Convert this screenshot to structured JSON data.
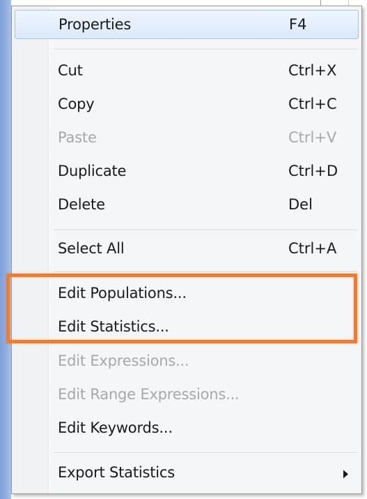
{
  "context_menu": {
    "items": [
      {
        "label": "Properties",
        "shortcut": "F4",
        "enabled": true,
        "hovered": true
      },
      {
        "label": "Cut",
        "shortcut": "Ctrl+X",
        "enabled": true
      },
      {
        "label": "Copy",
        "shortcut": "Ctrl+C",
        "enabled": true
      },
      {
        "label": "Paste",
        "shortcut": "Ctrl+V",
        "enabled": false
      },
      {
        "label": "Duplicate",
        "shortcut": "Ctrl+D",
        "enabled": true
      },
      {
        "label": "Delete",
        "shortcut": "Del",
        "enabled": true
      },
      {
        "label": "Select All",
        "shortcut": "Ctrl+A",
        "enabled": true
      },
      {
        "label": "Edit Populations...",
        "shortcut": "",
        "enabled": true
      },
      {
        "label": "Edit Statistics...",
        "shortcut": "",
        "enabled": true
      },
      {
        "label": "Edit Expressions...",
        "shortcut": "",
        "enabled": false
      },
      {
        "label": "Edit Range Expressions...",
        "shortcut": "",
        "enabled": false
      },
      {
        "label": "Edit Keywords...",
        "shortcut": "",
        "enabled": true
      },
      {
        "label": "Export Statistics",
        "shortcut": "",
        "enabled": true,
        "has_submenu": true
      }
    ]
  },
  "annotation": {
    "highlight_color": "#f07c30",
    "highlighted_items": [
      "Edit Populations...",
      "Edit Statistics..."
    ]
  },
  "colors": {
    "disabled_text": "#a8a8a8",
    "hover_border": "#9ec4ec"
  },
  "icons": {
    "submenu": "triangle-right"
  }
}
